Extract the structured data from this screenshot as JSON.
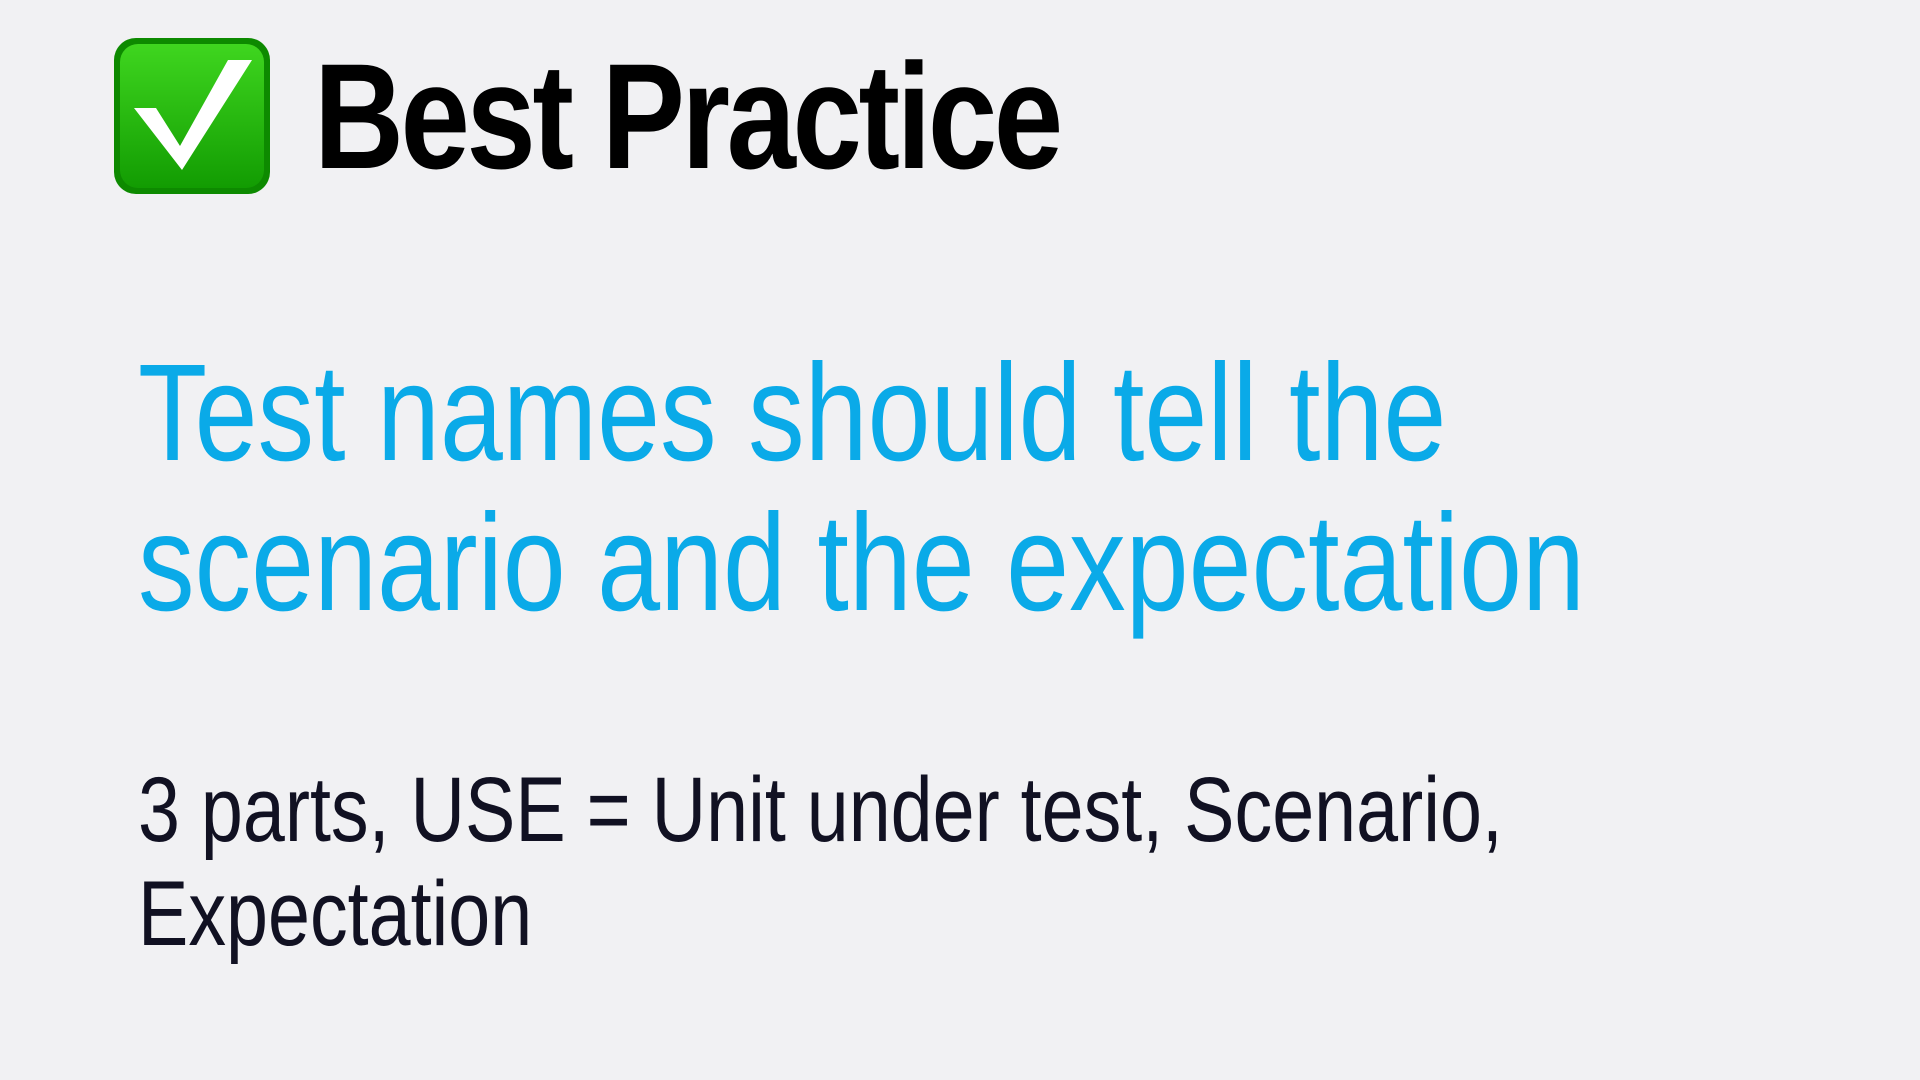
{
  "slide": {
    "icon": "check-mark-button-icon",
    "title": "Best Practice",
    "headline_lines": [
      "Test names should tell the",
      "scenario and the expectation"
    ],
    "detail_lines": [
      "3 parts, USE = Unit under test, Scenario,",
      "Expectation"
    ]
  },
  "colors": {
    "background": "#f1f1f3",
    "title": "#000000",
    "headline": "#0aaae8",
    "detail": "#111122",
    "badge_green": "#22b50a"
  }
}
